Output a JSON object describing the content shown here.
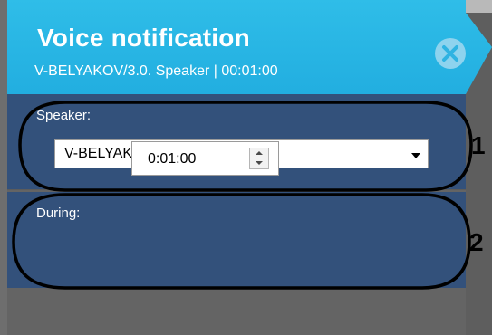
{
  "header": {
    "title": "Voice notification",
    "subtitle": "V-BELYAKOV/3.0. Speaker | 00:01:00",
    "close_icon": "close-icon",
    "accent_color": "#2bb8e6"
  },
  "speaker_section": {
    "label": "Speaker:",
    "selected_value": "V-BELYAKOV/3.0. Speaker",
    "dropdown_icon": "chevron-down-icon"
  },
  "during_section": {
    "label": "During:",
    "value": "0:01:00",
    "spin_icons": [
      "spin-up-icon",
      "spin-down-icon"
    ]
  },
  "annotations": {
    "marker_1": "1",
    "marker_2": "2"
  },
  "colors": {
    "panel_background": "#33517b",
    "header_background": "#2bb8e6",
    "annotation_outline": "#000000"
  }
}
